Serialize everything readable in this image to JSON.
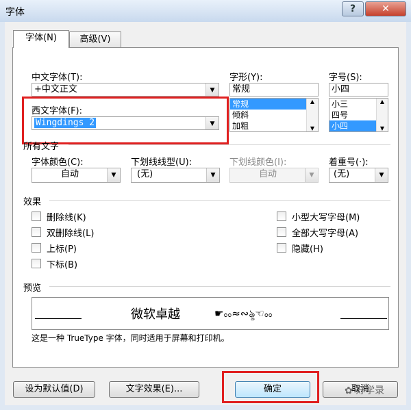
{
  "window": {
    "title": "字体",
    "help": "?",
    "close": "✕"
  },
  "tabs": [
    {
      "label": "字体(N)"
    },
    {
      "label": "高级(V)"
    }
  ],
  "fonts": {
    "chinese_label": "中文字体(T):",
    "chinese_value": "+中文正文",
    "western_label": "西文字体(F):",
    "western_value": "Wingdings 2"
  },
  "style": {
    "label": "字形(Y):",
    "value": "常规",
    "options": [
      "常规",
      "倾斜",
      "加粗"
    ]
  },
  "size": {
    "label": "字号(S):",
    "value": "小四",
    "options": [
      "小三",
      "四号",
      "小四"
    ]
  },
  "all_text": {
    "heading": "所有文字",
    "font_color_label": "字体颜色(C):",
    "font_color_value": "自动",
    "underline_style_label": "下划线线型(U):",
    "underline_style_value": "(无)",
    "underline_color_label": "下划线颜色(I):",
    "underline_color_value": "自动",
    "emphasis_label": "着重号(·):",
    "emphasis_value": "(无)"
  },
  "effects": {
    "heading": "效果",
    "left": [
      "删除线(K)",
      "双删除线(L)",
      "上标(P)",
      "下标(B)"
    ],
    "right": [
      "小型大写字母(M)",
      "全部大写字母(A)",
      "隐藏(H)"
    ]
  },
  "preview": {
    "heading": "预览",
    "sample_cn": "微软卓越",
    "sample_symbols": "☛ೲ≈∾ৡ☜ೲ",
    "note": "这是一种 TrueType 字体，同时适用于屏幕和打印机。"
  },
  "buttons": {
    "set_default": "设为默认值(D)",
    "text_effects": "文字效果(E)...",
    "ok": "确定",
    "cancel": "取消"
  },
  "watermark": "好学录",
  "colors": {
    "highlight": "#3399ff",
    "annotation_red": "#e02020"
  }
}
